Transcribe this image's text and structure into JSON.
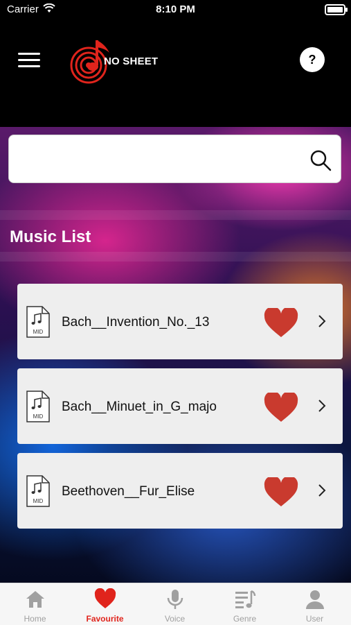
{
  "status_bar": {
    "carrier": "Carrier",
    "time": "8:10 PM"
  },
  "header": {
    "logo_text": "NO SHEET",
    "help_label": "?"
  },
  "search": {
    "value": "",
    "placeholder": ""
  },
  "section": {
    "title": "Music List"
  },
  "music_list": [
    {
      "name": "Bach__Invention_No._13",
      "file_type": "MID",
      "favourite": true
    },
    {
      "name": "Bach__Minuet_in_G_majo",
      "file_type": "MID",
      "favourite": true
    },
    {
      "name": "Beethoven__Fur_Elise",
      "file_type": "MID",
      "favourite": true
    }
  ],
  "tabs": [
    {
      "label": "Home",
      "icon": "home-icon",
      "active": false
    },
    {
      "label": "Favourite",
      "icon": "heart-icon",
      "active": true
    },
    {
      "label": "Voice",
      "icon": "microphone-icon",
      "active": false
    },
    {
      "label": "Genre",
      "icon": "music-list-icon",
      "active": false
    },
    {
      "label": "User",
      "icon": "user-icon",
      "active": false
    }
  ],
  "colors": {
    "accent": "#e0241c",
    "heart": "#c93a2e",
    "tab_inactive": "#a0a0a0",
    "card": "#eeeeee"
  }
}
